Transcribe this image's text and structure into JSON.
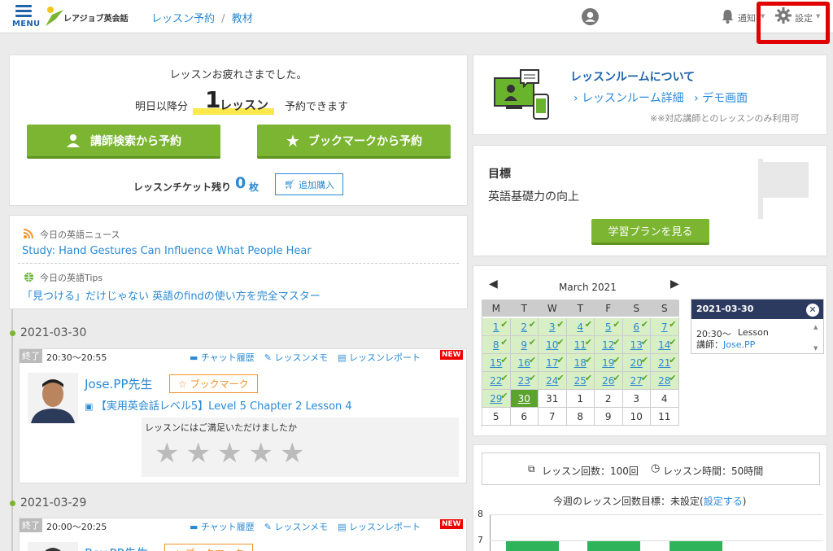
{
  "header": {
    "menu_label": "MENU",
    "logo_text": "レアジョブ英会話",
    "breadcrumb": [
      "レッスン予約",
      "教材"
    ],
    "breadcrumb_sep": "/",
    "notify_label": "通知",
    "settings_label": "設定"
  },
  "booking": {
    "greeting": "レッスンお疲れさまでした。",
    "from_tomorrow": "明日以降分",
    "count": "1",
    "unit": "レッスン",
    "suffix": "予約できます",
    "btn_teacher": "講師検索から予約",
    "btn_bookmark": "ブックマークから予約",
    "ticket_label": "レッスンチケット残り",
    "ticket_count": "0",
    "ticket_unit": "枚",
    "add_purchase": "追加購入"
  },
  "news": {
    "news_title": "今日の英語ニュース",
    "news_link": "Study: Hand Gestures Can Influence What People Hear",
    "tips_title": "今日の英語Tips",
    "tips_link": "「見つける」だけじゃない 英語のfindの使い方を完全マスター"
  },
  "lessons": [
    {
      "date": "2021-03-30",
      "status": "終了",
      "time": "20:30〜20:55",
      "chat": "チャット履歴",
      "memo": "レッスンメモ",
      "report": "レッスンレポート",
      "new_badge": "NEW",
      "teacher": "Jose.PP先生",
      "bookmark": "☆ ブックマーク",
      "material": "【実用英会話レベル5】Level 5 Chapter 2 Lesson 4",
      "rating_q": "レッスンにはご満足いただけましたか",
      "stars": 0
    },
    {
      "date": "2021-03-29",
      "status": "終了",
      "time": "20:00〜20:25",
      "chat": "チャット履歴",
      "memo": "レッスンメモ",
      "report": "レッスンレポート",
      "new_badge": "NEW",
      "teacher": "Rey.PP先生",
      "bookmark": "☆ ブックマーク"
    }
  ],
  "room": {
    "title": "レッスンルームについて",
    "link1": "レッスンルーム詳細",
    "link2": "デモ画面",
    "note": "※※対応講師とのレッスンのみ利用可"
  },
  "goal": {
    "title": "目標",
    "text": "英語基礎力の向上",
    "btn": "学習プランを見る"
  },
  "calendar": {
    "month": "March 2021",
    "weekdays": [
      "M",
      "T",
      "W",
      "T",
      "F",
      "S",
      "S"
    ],
    "weeks": [
      [
        "1",
        "2",
        "3",
        "4",
        "5",
        "6",
        "7"
      ],
      [
        "8",
        "9",
        "10",
        "11",
        "12",
        "13",
        "14"
      ],
      [
        "15",
        "16",
        "17",
        "18",
        "19",
        "20",
        "21"
      ],
      [
        "22",
        "23",
        "24",
        "25",
        "26",
        "27",
        "28"
      ],
      [
        "29",
        "30",
        "31",
        "1",
        "2",
        "3",
        "4"
      ],
      [
        "5",
        "6",
        "7",
        "8",
        "9",
        "10",
        "11"
      ]
    ],
    "selected": "30",
    "popup": {
      "date": "2021-03-30",
      "time": "20:30〜",
      "type": "Lesson",
      "teacher_label": "講師：",
      "teacher": "Jose.PP"
    }
  },
  "stats": {
    "count_label": "レッスン回数：100回",
    "time_label": "レッスン時間：50時間",
    "weekly_goal": "今週のレッスン回数目標：",
    "weekly_value": "未設定(",
    "weekly_link": "設定する",
    "weekly_close": ")",
    "y_ticks": [
      "8",
      "7"
    ]
  },
  "colors": {
    "accent_green": "#7cb532",
    "link_blue": "#2a8ad4",
    "highlight_red": "#e00000",
    "navy": "#2d3a5f"
  }
}
